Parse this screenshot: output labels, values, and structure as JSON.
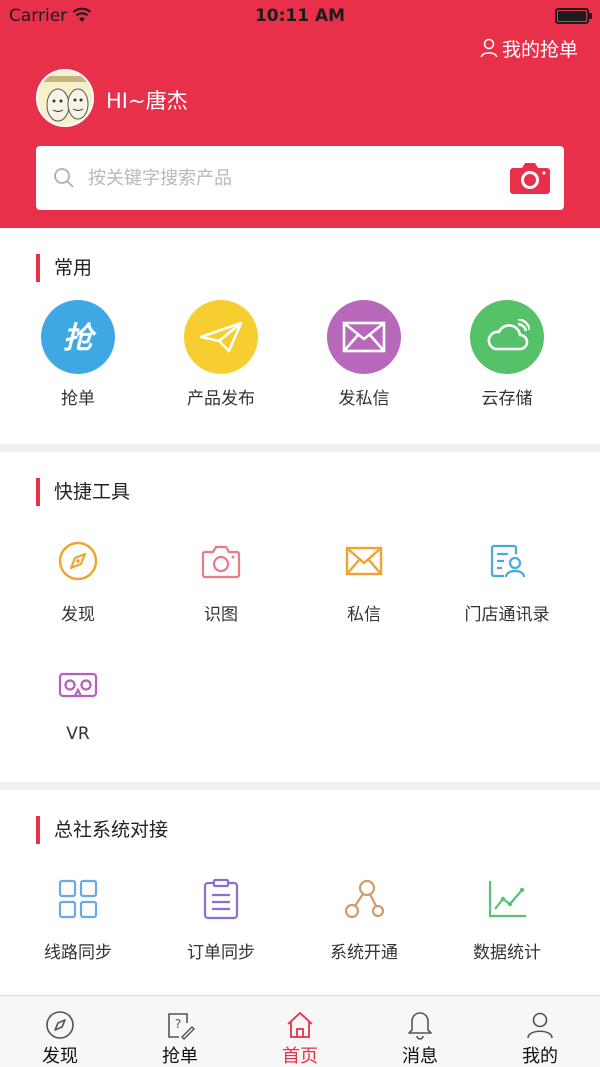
{
  "status_bar": {
    "carrier": "Carrier",
    "time": "10:11 AM"
  },
  "header": {
    "my_orders": "我的抢单",
    "greeting": "HI~唐杰",
    "search_placeholder": "按关键字搜索产品",
    "brand_color": "#e8304a"
  },
  "common": {
    "title": "常用",
    "items": [
      {
        "label": "抢单",
        "icon": "grab-icon",
        "color": "#3ea8e5"
      },
      {
        "label": "产品发布",
        "icon": "paper-plane-icon",
        "color": "#f7ce2f"
      },
      {
        "label": "发私信",
        "icon": "envelope-icon",
        "color": "#b868bb"
      },
      {
        "label": "云存储",
        "icon": "cloud-icon",
        "color": "#55c26a"
      }
    ]
  },
  "tools": {
    "title": "快捷工具",
    "items": [
      {
        "label": "发现",
        "icon": "compass-icon",
        "color": "#f0a32e"
      },
      {
        "label": "识图",
        "icon": "camera-icon",
        "color": "#ea7b86"
      },
      {
        "label": "私信",
        "icon": "envelope-icon",
        "color": "#f0a32e"
      },
      {
        "label": "门店通讯录",
        "icon": "contacts-icon",
        "color": "#4aa8dd"
      },
      {
        "label": "VR",
        "icon": "vr-glasses-icon",
        "color": "#b85fbd"
      }
    ]
  },
  "hq": {
    "title": "总社系统对接",
    "items": [
      {
        "label": "线路同步",
        "icon": "grid-icon",
        "color": "#6aa8e8"
      },
      {
        "label": "订单同步",
        "icon": "clipboard-icon",
        "color": "#8c70d0"
      },
      {
        "label": "系统开通",
        "icon": "nodes-icon",
        "color": "#d29a6a"
      },
      {
        "label": "数据统计",
        "icon": "line-chart-icon",
        "color": "#58c274"
      }
    ]
  },
  "tabbar": {
    "tabs": [
      {
        "label": "发现",
        "icon": "compass-icon"
      },
      {
        "label": "抢单",
        "icon": "edit-doc-icon"
      },
      {
        "label": "首页",
        "icon": "home-icon",
        "active": true
      },
      {
        "label": "消息",
        "icon": "bell-icon"
      },
      {
        "label": "我的",
        "icon": "user-icon"
      }
    ]
  }
}
